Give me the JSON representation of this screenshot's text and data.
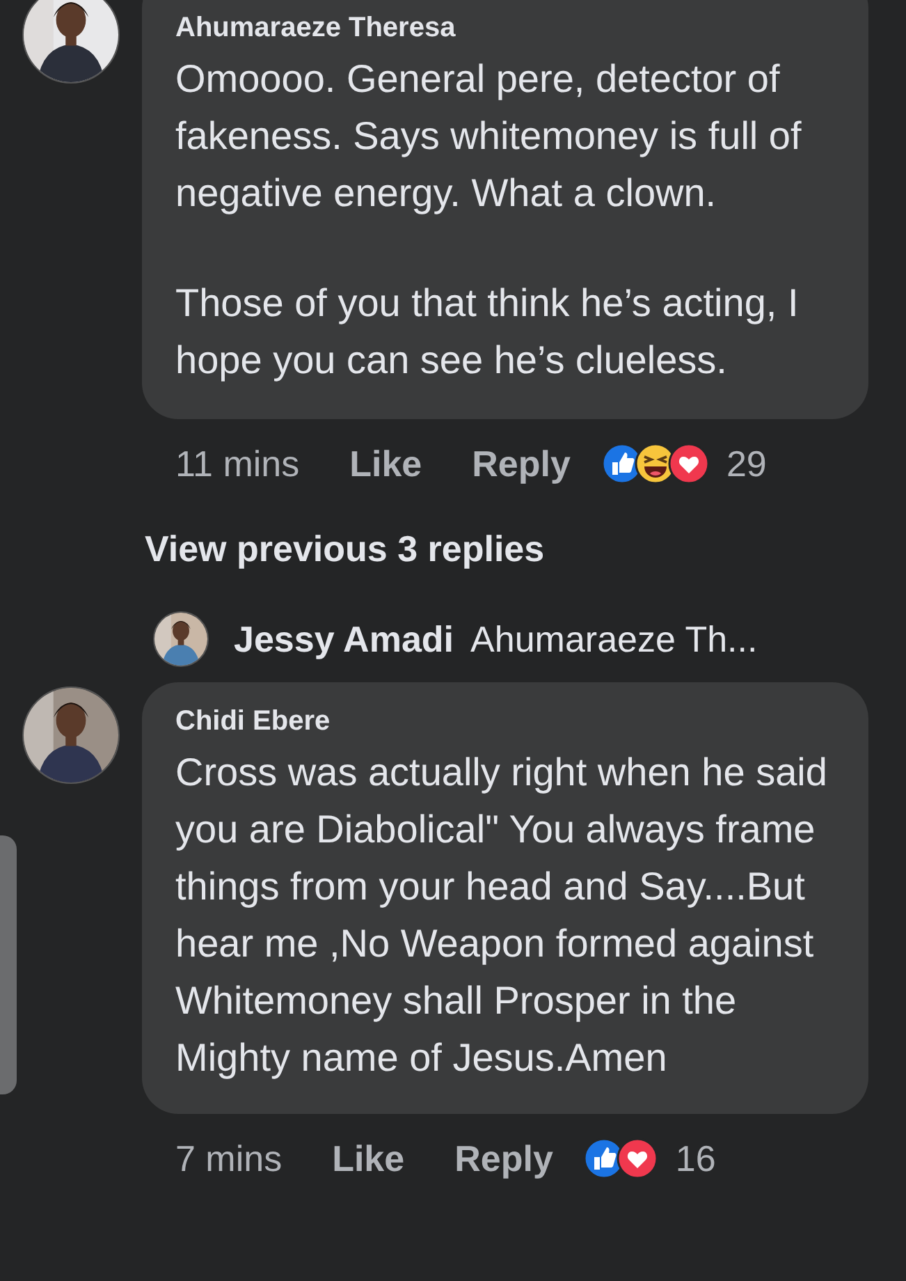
{
  "comments": [
    {
      "author": "Ahumaraeze Theresa",
      "paragraphs": [
        "Omoooo. General pere, detector of fakeness. Says whitemoney is full of negative energy. What a clown.",
        "Those of you that think he’s acting, I hope you can see he’s clueless."
      ],
      "time": "11 mins",
      "actions": [
        "Like",
        "Reply"
      ],
      "reactions": [
        {
          "kind": "like"
        },
        {
          "kind": "haha"
        },
        {
          "kind": "love"
        }
      ],
      "reaction_count": "29",
      "view_replies": "View previous 3 replies",
      "reply_preview": {
        "author": "Jessy Amadi",
        "text": "Ahumaraeze Th..."
      }
    },
    {
      "author": "Chidi Ebere",
      "paragraphs": [
        "Cross was actually right when he said you are Diabolical\" You always frame things from your head and Say....But hear me ,No Weapon formed against Whitemoney shall Prosper in the Mighty name of Jesus.Amen"
      ],
      "time": "7 mins",
      "actions": [
        "Like",
        "Reply"
      ],
      "reactions": [
        {
          "kind": "like"
        },
        {
          "kind": "love"
        }
      ],
      "reaction_count": "16"
    }
  ]
}
